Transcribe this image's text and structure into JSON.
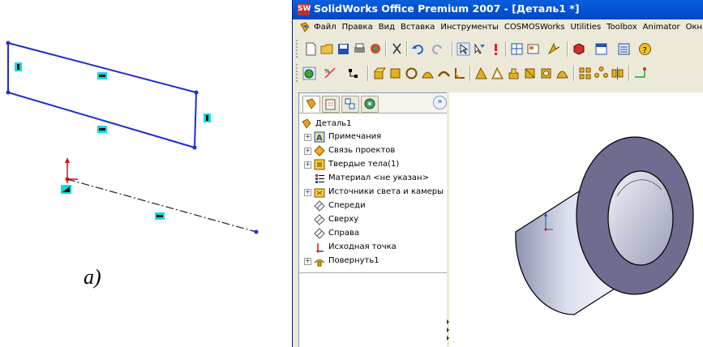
{
  "figure_label": "а)",
  "window": {
    "title": "SolidWorks Office Premium 2007 - [Деталь1 *]",
    "app_icon": "solidworks-logo-icon"
  },
  "menubar": {
    "items": [
      "Файл",
      "Правка",
      "Вид",
      "Вставка",
      "Инструменты",
      "COSMOSWorks",
      "Utilities",
      "Toolbox",
      "Animator",
      "Окн"
    ]
  },
  "feature_manager": {
    "tabs": [
      "featuremanager-tab",
      "propertymanager-tab",
      "configurationmanager-tab",
      "display-tab"
    ],
    "root": "Деталь1",
    "items": [
      {
        "label": "Примечания",
        "expandable": true,
        "icon": "annotations-icon"
      },
      {
        "label": "Связь проектов",
        "expandable": true,
        "icon": "design-binder-icon"
      },
      {
        "label": "Твердые тела(1)",
        "expandable": true,
        "icon": "solid-bodies-icon"
      },
      {
        "label": "Материал <не указан>",
        "expandable": false,
        "icon": "material-icon"
      },
      {
        "label": "Источники света и камеры",
        "expandable": true,
        "icon": "lights-cameras-icon"
      },
      {
        "label": "Спереди",
        "expandable": false,
        "icon": "plane-icon"
      },
      {
        "label": "Сверху",
        "expandable": false,
        "icon": "plane-icon"
      },
      {
        "label": "Справа",
        "expandable": false,
        "icon": "plane-icon"
      },
      {
        "label": "Исходная точка",
        "expandable": false,
        "icon": "origin-icon"
      },
      {
        "label": "Повернуть1",
        "expandable": true,
        "icon": "revolve-feature-icon"
      }
    ],
    "collapse_glyph": "»"
  },
  "colors": {
    "titlebar": "#0054e3",
    "sketch_line": "#1f2bd6",
    "relation_marker": "#00e0e0",
    "part_face": "#c8cde0",
    "inner_face": "#6e6c8f"
  }
}
